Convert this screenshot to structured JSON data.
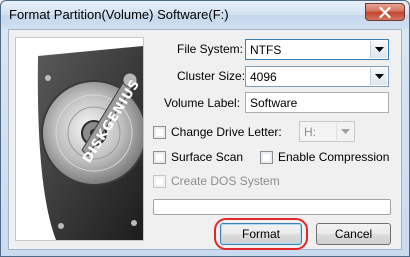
{
  "window": {
    "title": "Format Partition(Volume) Software(F:)",
    "close_icon": "close-icon"
  },
  "brand": {
    "logo_text": "DISKGENIUS"
  },
  "form": {
    "file_system_label": "File System:",
    "file_system_value": "NTFS",
    "cluster_size_label": "Cluster Size:",
    "cluster_size_value": "4096",
    "volume_label_label": "Volume Label:",
    "volume_label_value": "Software",
    "change_drive_letter_label": "Change Drive Letter:",
    "drive_letter_value": "H:",
    "surface_scan_label": "Surface Scan",
    "enable_compression_label": "Enable Compression",
    "create_dos_system_label": "Create DOS System",
    "progress": 0
  },
  "buttons": {
    "format_label": "Format",
    "cancel_label": "Cancel"
  },
  "colors": {
    "highlight_ring": "#e3262a",
    "close_button": "#c2442c"
  }
}
